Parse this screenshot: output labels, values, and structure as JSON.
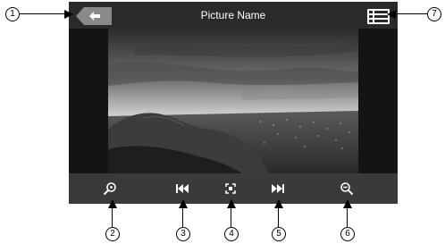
{
  "header": {
    "title": "Picture Name"
  },
  "toolbar": {
    "items": [
      {
        "icon": "zoom-in-icon"
      },
      {
        "icon": "previous-icon"
      },
      {
        "icon": "fit-screen-icon"
      },
      {
        "icon": "next-icon"
      },
      {
        "icon": "zoom-out-icon"
      }
    ]
  },
  "callouts": {
    "c1": "1",
    "c2": "2",
    "c3": "3",
    "c4": "4",
    "c5": "5",
    "c6": "6",
    "c7": "7"
  },
  "colors": {
    "screen_bg": "#1d1d1d",
    "toolbar_bg": "#3a3a3a",
    "back_button": "#8a8a8a"
  }
}
